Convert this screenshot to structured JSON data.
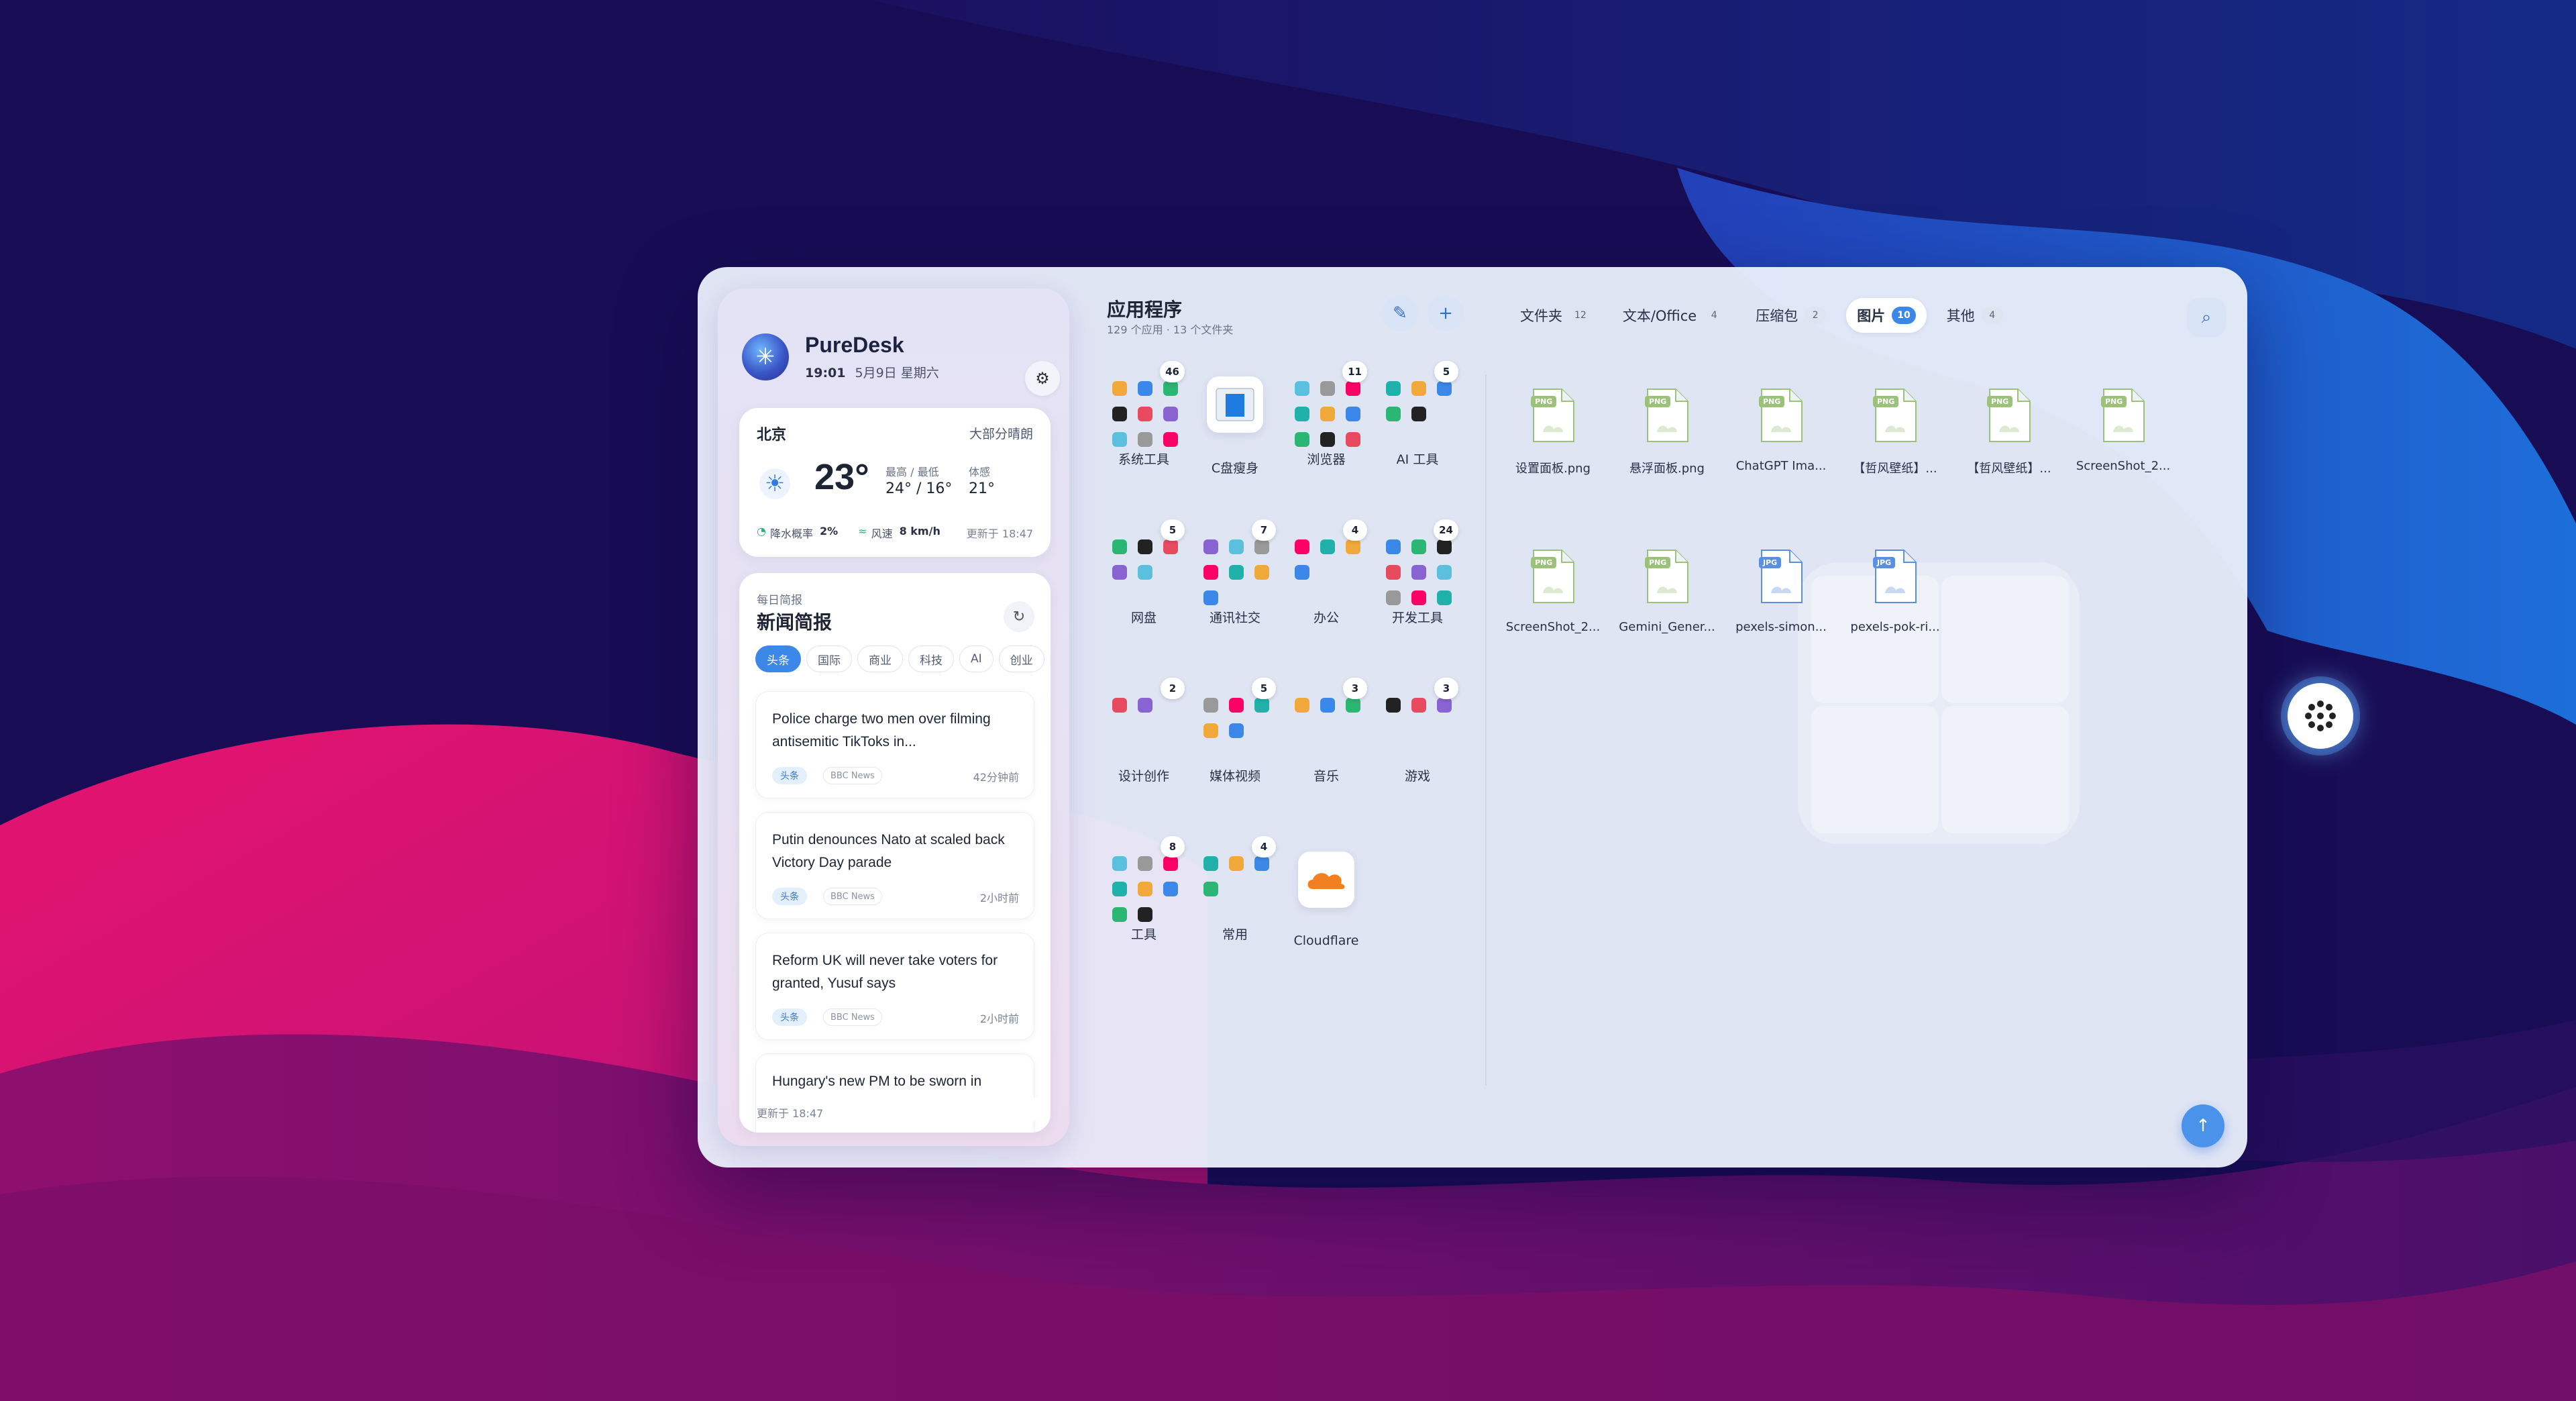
{
  "brand": {
    "name": "PureDesk",
    "time": "19:01",
    "date": "5月9日 星期六"
  },
  "weather": {
    "city": "北京",
    "condition": "大部分晴朗",
    "temp": "23°",
    "hl_label": "最高 / 最低",
    "hl_value": "24° / 16°",
    "feel_label": "体感",
    "feel_value": "21°",
    "rain_label": "降水概率",
    "rain_value": "2%",
    "wind_label": "风速",
    "wind_value": "8 km/h",
    "updated": "更新于 18:47"
  },
  "news": {
    "label": "每日简报",
    "title": "新闻简报",
    "tabs": [
      "头条",
      "国际",
      "商业",
      "科技",
      "AI",
      "创业"
    ],
    "items": [
      {
        "title": "Police charge two men over filming antisemitic TikToks in...",
        "tag": "头条",
        "source": "BBC News",
        "time": "42分钟前"
      },
      {
        "title": "Putin denounces Nato at scaled back Victory Day parade",
        "tag": "头条",
        "source": "BBC News",
        "time": "2小时前"
      },
      {
        "title": "Reform UK will never take voters for granted, Yusuf says",
        "tag": "头条",
        "source": "BBC News",
        "time": "2小时前"
      },
      {
        "title": "Hungary's new PM to be sworn in during 'regime change' party",
        "tag": "",
        "source": "",
        "time": ""
      }
    ],
    "updated": "更新于 18:47"
  },
  "apps": {
    "title": "应用程序",
    "subtitle": "129 个应用 · 13 个文件夹",
    "edit_icon": "pencil-icon",
    "add_label": "+",
    "folders": [
      {
        "label": "系统工具",
        "count": "46"
      },
      {
        "label": "C盘瘦身",
        "count": ""
      },
      {
        "label": "浏览器",
        "count": "11"
      },
      {
        "label": "AI 工具",
        "count": "5"
      },
      {
        "label": "网盘",
        "count": "5"
      },
      {
        "label": "通讯社交",
        "count": "7"
      },
      {
        "label": "办公",
        "count": "4"
      },
      {
        "label": "开发工具",
        "count": "24"
      },
      {
        "label": "设计创作",
        "count": "2"
      },
      {
        "label": "媒体视频",
        "count": "5"
      },
      {
        "label": "音乐",
        "count": "3"
      },
      {
        "label": "游戏",
        "count": "3"
      },
      {
        "label": "工具",
        "count": "8"
      },
      {
        "label": "常用",
        "count": "4"
      },
      {
        "label": "Cloudflare",
        "count": ""
      }
    ]
  },
  "files": {
    "tabs": [
      {
        "label": "文件夹",
        "count": "12"
      },
      {
        "label": "文本/Office",
        "count": "4"
      },
      {
        "label": "压缩包",
        "count": "2"
      },
      {
        "label": "图片",
        "count": "10"
      },
      {
        "label": "其他",
        "count": "4"
      }
    ],
    "items": [
      {
        "name": "设置面板.png",
        "ext": "PNG"
      },
      {
        "name": "悬浮面板.png",
        "ext": "PNG"
      },
      {
        "name": "ChatGPT Ima...",
        "ext": "PNG"
      },
      {
        "name": "【哲风壁纸】...",
        "ext": "PNG"
      },
      {
        "name": "【哲风壁纸】...",
        "ext": "PNG"
      },
      {
        "name": "ScreenShot_2...",
        "ext": "PNG"
      },
      {
        "name": "ScreenShot_2...",
        "ext": "PNG"
      },
      {
        "name": "Gemini_Gener...",
        "ext": "PNG"
      },
      {
        "name": "pexels-simon...",
        "ext": "JPG"
      },
      {
        "name": "pexels-pok-ri...",
        "ext": "JPG"
      }
    ]
  },
  "colors": {
    "accent": "#3b88e8",
    "png": "#9bc27a",
    "jpg": "#5b8fe0",
    "bg_navy": "#190f5c",
    "bg_pink": "#e0106f"
  },
  "icons": {
    "settings": "gear-icon",
    "refresh": "refresh-icon",
    "search": "search-icon",
    "top": "arrow-up-icon",
    "float": "dots-grid-icon"
  },
  "labels": {
    "top_arrow": "↑"
  }
}
